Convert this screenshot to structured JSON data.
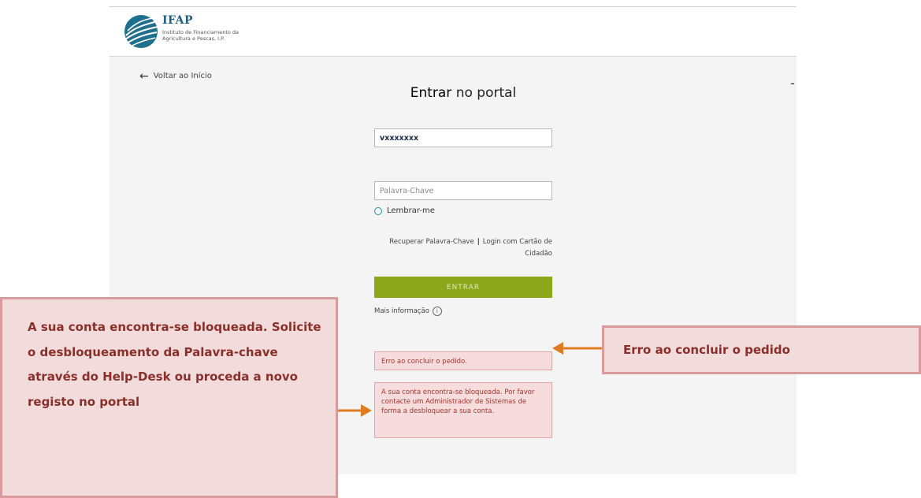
{
  "logo": {
    "title": "IFAP",
    "subtitle": "Instituto de Financiamento da Agricultura e Pescas, I.P."
  },
  "nav": {
    "back_label": "Voltar ao Início"
  },
  "login": {
    "title_bold": "Entrar",
    "title_rest": " no portal",
    "username_value": "vxxxxxxx",
    "password_placeholder": "Palavra-Chave",
    "remember_label": "Lembrar-me",
    "recover_link": "Recuperar Palavra-Chave",
    "citizen_card_link": "Login com Cartão de Cidadão",
    "submit_label": "ENTRAR",
    "more_info_label": "Mais informação",
    "info_icon_glyph": "i"
  },
  "errors": {
    "request_error": "Erro ao concluir o pedido.",
    "locked_error": "A sua conta encontra-se bloqueada. Por favor contacte um Administrador de Sistemas de forma a desbloquear a sua conta."
  },
  "annotations": {
    "left_callout": "A sua conta encontra-se bloqueada. Solicite o desbloqueamento da Palavra-chave através do Help-Desk ou proceda a novo registo no portal",
    "right_callout": "Erro ao concluir o pedido"
  },
  "colors": {
    "brand_blue": "#1f5f86",
    "submit_green": "#8da71b",
    "error_bg": "#f6dcdc",
    "error_text": "#a8342d",
    "callout_bg": "#f2dbdb",
    "callout_border": "#d79b9b",
    "arrow_orange": "#e07b1f"
  }
}
